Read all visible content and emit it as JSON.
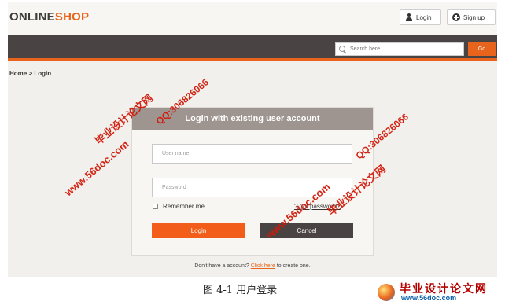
{
  "header": {
    "logo_part1": "ONLINE",
    "logo_part2": "SHOP",
    "login_label": "Login",
    "signup_label": "Sign up"
  },
  "search": {
    "placeholder": "Search here",
    "button_label": "Go"
  },
  "breadcrumb": "Home > Login",
  "login_panel": {
    "title": "Login with existing user account",
    "username_placeholder": "User name",
    "password_placeholder": "Password",
    "remember_label": "Remember me",
    "forgot_label": "? got password?",
    "login_button": "Login",
    "cancel_button": "Cancel"
  },
  "footer": {
    "prefix": "Don't have a account?",
    "link": "Click here",
    "suffix": "to create one."
  },
  "caption": "图 4-1   用户登录",
  "watermarks": {
    "site_name": "毕业设计论文网",
    "url": "www.56doc.com",
    "qq": "QQ:306826066"
  },
  "badge": {
    "title": "毕业设计论文网",
    "url": "www.56doc.com"
  },
  "colors": {
    "accent": "#e8641c",
    "nav_dark": "#4a4343",
    "panel_header": "#9e9591",
    "watermark": "#d11a0a"
  }
}
